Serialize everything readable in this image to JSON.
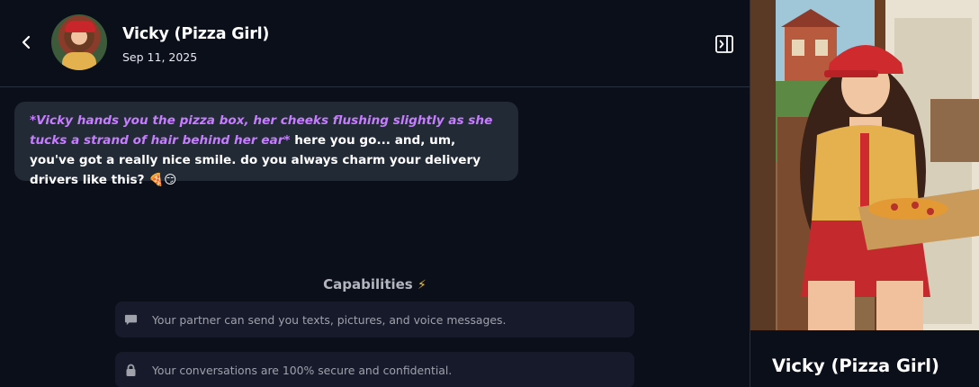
{
  "header": {
    "name": "Vicky (Pizza Girl)",
    "date": "Sep 11, 2025"
  },
  "message": {
    "action": "*Vicky hands you the pizza box, her cheeks flushing slightly as she tucks a strand of hair behind her ear*",
    "text": " here you go... and, um, you've got a really nice smile. do you always charm your delivery drivers like this? 🍕😏"
  },
  "capabilities": {
    "title": "Capabilities",
    "bolt": "⚡",
    "items": [
      {
        "icon": "chat-bubble-icon",
        "text": "Your partner can send you texts, pictures, and voice messages."
      },
      {
        "icon": "lock-icon",
        "text": "Your conversations are 100% secure and confidential."
      }
    ]
  },
  "side_panel": {
    "name": "Vicky (Pizza Girl)"
  },
  "colors": {
    "background": "#0b0f1a",
    "bubble": "#222a36",
    "action_text": "#c77dff",
    "capability_card": "#171a2a",
    "bolt": "#f5c518"
  }
}
